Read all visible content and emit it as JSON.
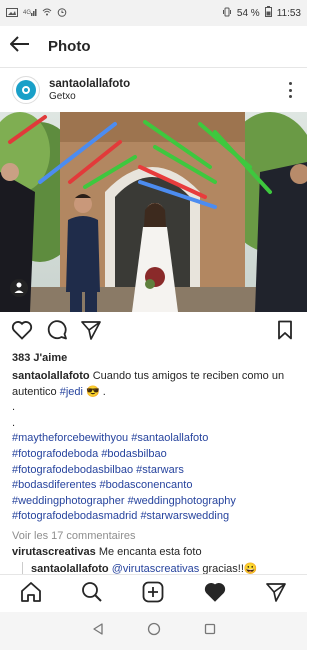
{
  "status_bar": {
    "battery": "54 %",
    "time": "11:53"
  },
  "header": {
    "title": "Photo"
  },
  "post": {
    "username": "santaolallafoto",
    "location": "Getxo",
    "likes": "383 J'aime",
    "caption_text": "Cuando tus amigos te reciben como un autentico",
    "caption_tag": "#jedi",
    "caption_emoji": "😎 .",
    "dot1": ".",
    "dot2": ".",
    "hashtags": [
      "#maytheforcebewithyou",
      "#santaolallafoto",
      "#fotografodeboda",
      "#bodasbilbao",
      "#fotografodebodasbilbao",
      "#starwars",
      "#bodasdiferentes",
      "#bodasconencanto",
      "#weddingphotographer",
      "#weddingphotography",
      "#fotografodebodasmadrid",
      "#starwarswedding"
    ],
    "view_comments": "Voir les 17 commentaires",
    "comment": {
      "user": "virutascreativas",
      "text": "Me encanta esta foto"
    },
    "reply": {
      "user": "santaolallafoto",
      "mention": "@virutascreativas",
      "text": "gracias!!😀"
    }
  },
  "colors": {
    "hashtag": "#27449e",
    "secondary_text": "#8e8e8e",
    "avatar": "#1aa0c8"
  }
}
